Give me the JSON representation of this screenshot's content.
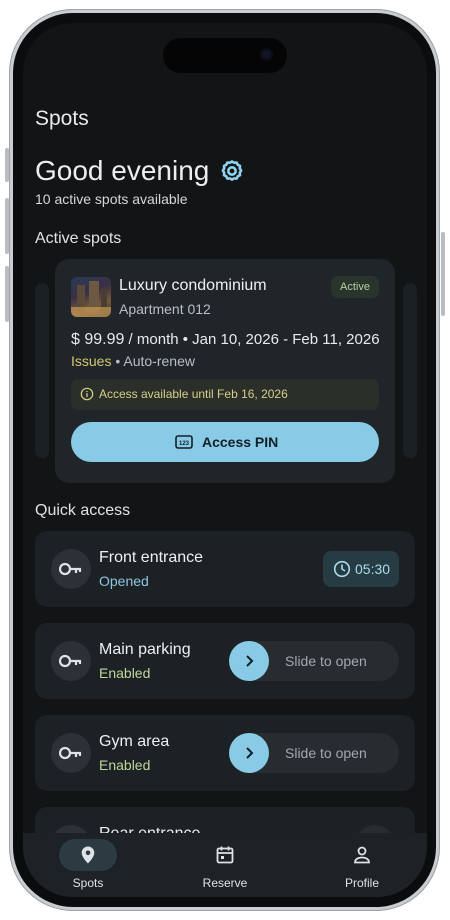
{
  "app": {
    "title": "Spots"
  },
  "greeting": {
    "text": "Good evening",
    "subtitle": "10 active spots available"
  },
  "sections": {
    "active": "Active spots",
    "quick": "Quick access"
  },
  "active_card": {
    "title": "Luxury condominium",
    "subtitle": "Apartment 012",
    "badge": "Active",
    "price": "$ 99.99",
    "price_rest": " / month • Jan 10, 2026 - Feb 11, 2026",
    "issues": "Issues",
    "renew": " • Auto-renew",
    "access_note": "Access available until Feb 16, 2026",
    "pin_button": "Access PIN"
  },
  "quick_access": [
    {
      "name": "Front entrance",
      "state": "Opened",
      "timer": "05:30"
    },
    {
      "name": "Main parking",
      "state": "Enabled",
      "action": "Slide to open"
    },
    {
      "name": "Gym area",
      "state": "Enabled",
      "action": "Slide to open"
    },
    {
      "name": "Rear entrance"
    }
  ],
  "nav": [
    {
      "label": "Spots",
      "icon": "location-pin-icon",
      "selected": true
    },
    {
      "label": "Reserve",
      "icon": "calendar-icon"
    },
    {
      "label": "Profile",
      "icon": "person-icon"
    }
  ],
  "colors": {
    "accent": "#89cbe6",
    "background": "#121416",
    "card": "#1f2529",
    "warning": "#d7c86e",
    "success": "#c3d69a"
  }
}
